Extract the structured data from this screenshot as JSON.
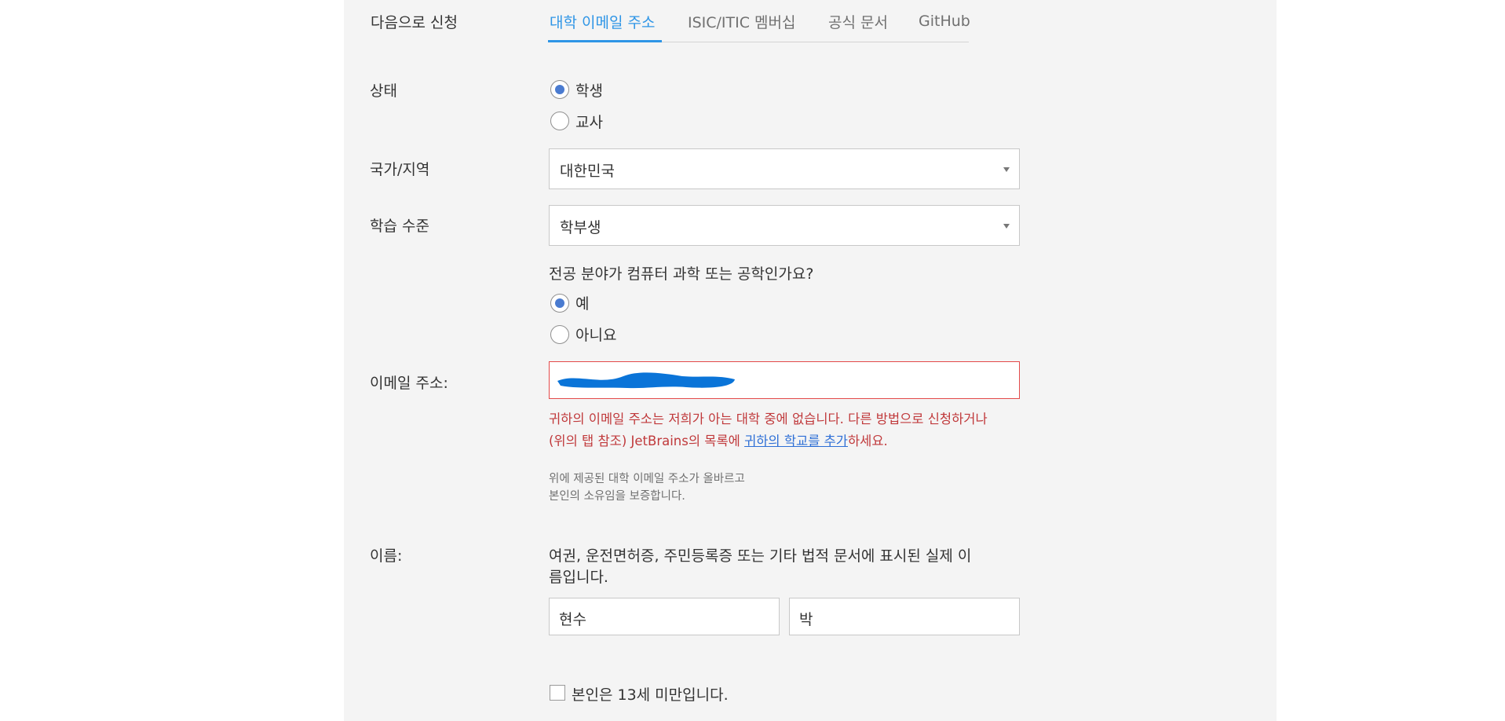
{
  "apply_with": {
    "label": "다음으로 신청",
    "tabs": [
      {
        "label": "대학 이메일 주소",
        "active": true
      },
      {
        "label": "ISIC/ITIC 멤버십",
        "active": false
      },
      {
        "label": "공식 문서",
        "active": false
      },
      {
        "label": "GitHub",
        "active": false
      }
    ]
  },
  "status": {
    "label": "상태",
    "options": [
      {
        "label": "학생",
        "checked": true
      },
      {
        "label": "교사",
        "checked": false
      }
    ]
  },
  "country": {
    "label": "국가/지역",
    "value": "대한민국"
  },
  "level": {
    "label": "학습 수준",
    "value": "학부생"
  },
  "major": {
    "question": "전공 분야가 컴퓨터 과학 또는 공학인가요?",
    "options": [
      {
        "label": "예",
        "checked": true
      },
      {
        "label": "아니요",
        "checked": false
      }
    ]
  },
  "email": {
    "label": "이메일 주소:",
    "error_line1": "귀하의 이메일 주소는 저희가 아는 대학 중에 없습니다. 다른 방법으로 신청하거나",
    "error_line2_pre": "(위의 탭 참조) JetBrains의 목록에 ",
    "error_link": "귀하의 학교를 추가",
    "error_line2_post": "하세요.",
    "note_line1": "위에 제공된 대학 이메일 주소가 올바르고",
    "note_line2": "본인의 소유임을 보증합니다."
  },
  "name": {
    "label": "이름:",
    "hint_line1": "여권, 운전면허증, 주민등록증 또는 기타 법적 문서에 표시된 실제 이",
    "hint_line2": "름입니다.",
    "first": "현수",
    "last": "박"
  },
  "under13": {
    "label": "본인은 13세 미만입니다."
  },
  "colors": {
    "accent": "#2e95e6",
    "error": "#c0393b",
    "redaction": "#0a74d8"
  }
}
